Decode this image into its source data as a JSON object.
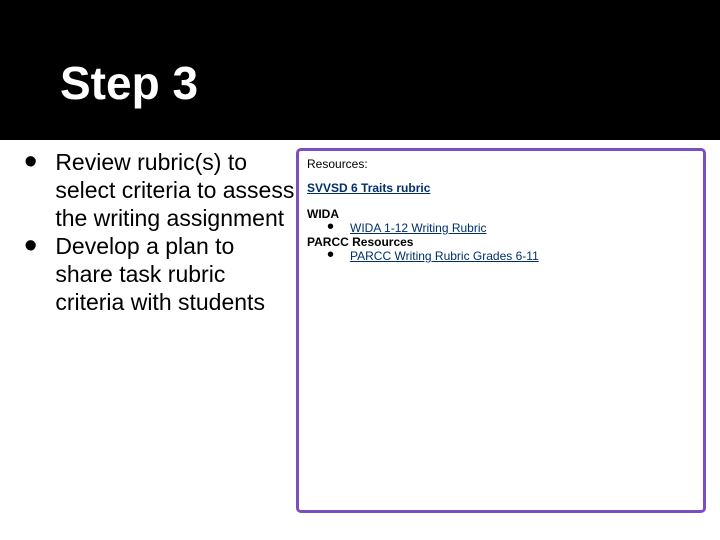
{
  "title": "Step 3",
  "left": {
    "b1": "Review rubric(s) to select criteria to assess the writing assignment",
    "b2": "Develop a plan to share task rubric criteria with students"
  },
  "right": {
    "resources_label": "Resources:",
    "svvsd_link": "SVVSD 6 Traits rubric",
    "wida_label": "WIDA",
    "wida_link": "WIDA 1-12 Writing Rubric",
    "parcc_label": "PARCC Resources",
    "parcc_link": "PARCC Writing Rubric Grades 6-11"
  }
}
